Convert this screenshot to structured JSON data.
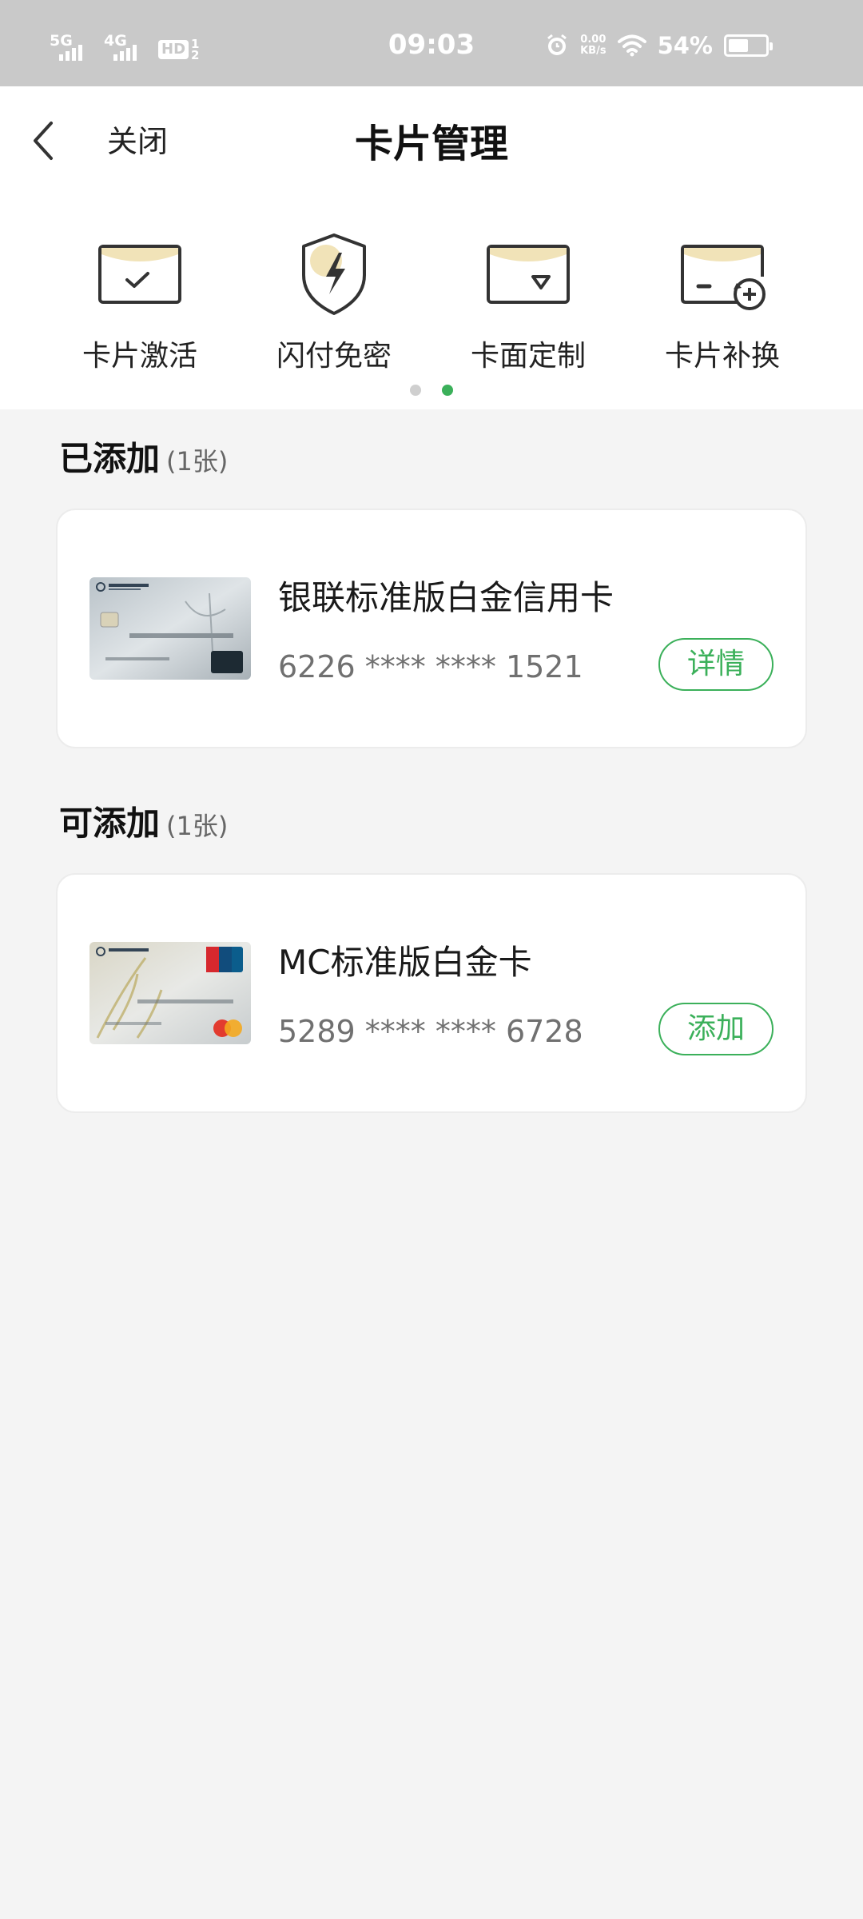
{
  "status_bar": {
    "sim1_network": "5G",
    "sim2_network": "4G",
    "hd_label": "HD",
    "hd_fraction_top": "1",
    "hd_fraction_bottom": "2",
    "time": "09:03",
    "speed_value": "0.00",
    "speed_unit": "KB/s",
    "battery_percent": "54%",
    "battery_level": 0.54
  },
  "header": {
    "close_label": "关闭",
    "title": "卡片管理"
  },
  "functions": [
    {
      "label": "卡片激活",
      "icon": "card-activate-icon"
    },
    {
      "label": "闪付免密",
      "icon": "quickpass-shield-icon"
    },
    {
      "label": "卡面定制",
      "icon": "card-customize-icon"
    },
    {
      "label": "卡片补换",
      "icon": "card-replace-icon"
    }
  ],
  "pager": {
    "pages": 2,
    "active": 2
  },
  "added_section": {
    "title": "已添加",
    "count": "(1张)",
    "cards": [
      {
        "name": "银联标准版白金信用卡",
        "number": "6226 **** **** 1521",
        "action_label": "详情"
      }
    ]
  },
  "addable_section": {
    "title": "可添加",
    "count": "(1张)",
    "cards": [
      {
        "name": "MC标准版白金卡",
        "number": "5289 **** **** 6728",
        "action_label": "添加"
      }
    ]
  },
  "colors": {
    "accent_green": "#3bb05a",
    "status_bar_bg": "#c9c9c9",
    "page_bg": "#f4f4f4",
    "icon_gold": "#f1e3b8"
  }
}
